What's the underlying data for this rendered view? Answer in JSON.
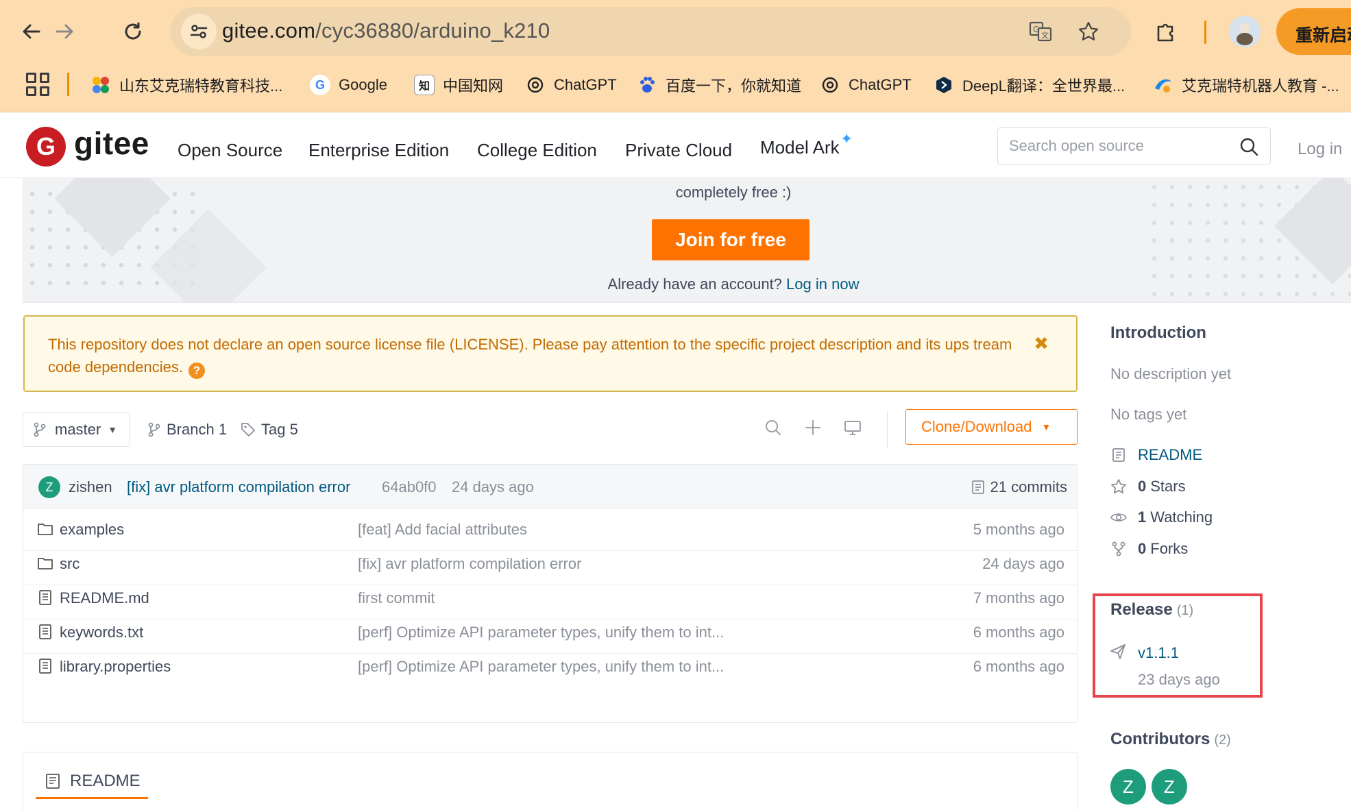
{
  "browser": {
    "url_host": "gitee.com",
    "url_path": "/cyc36880/arduino_k210",
    "relaunch_label": "重新启动",
    "bookmarks": [
      {
        "label": "山东艾克瑞特教育科技...",
        "icon": "colorful-dots-icon"
      },
      {
        "label": "Google",
        "icon": "google-icon"
      },
      {
        "label": "中国知网",
        "icon": "cnki-icon"
      },
      {
        "label": "ChatGPT",
        "icon": "openai-icon"
      },
      {
        "label": "百度一下，你就知道",
        "icon": "baidu-icon"
      },
      {
        "label": "ChatGPT",
        "icon": "openai-icon"
      },
      {
        "label": "DeepL翻译：全世界最...",
        "icon": "deepl-icon"
      },
      {
        "label": "艾克瑞特机器人教育 -...",
        "icon": "blue-swoosh-icon"
      }
    ]
  },
  "header": {
    "logo_letter": "G",
    "logo_text": "gitee",
    "nav": [
      "Open Source",
      "Enterprise Edition",
      "College Edition",
      "Private Cloud",
      "Model Ark"
    ],
    "search_placeholder": "Search open source",
    "login_label": "Log in"
  },
  "hero": {
    "tagline_tail": "completely free :)",
    "join_label": "Join for free",
    "account_text": "Already have an account?",
    "login_now": "Log in now"
  },
  "alert": {
    "text": "This repository does not declare an open source license file (LICENSE). Please pay attention to the specific project description and its ups tream code dependencies.",
    "help": "?",
    "close": "✖"
  },
  "toolbar": {
    "branch": "master",
    "branch_count": "Branch 1",
    "tag_count": "Tag 5",
    "clone_label": "Clone/Download"
  },
  "commit": {
    "avatar": "Z",
    "author": "zishen",
    "message": "[fix] avr platform compilation error",
    "sha": "64ab0f0",
    "time": "24 days ago",
    "commits": "21 commits"
  },
  "files": [
    {
      "name": "examples",
      "type": "folder",
      "message": "[feat] Add facial attributes",
      "time": "5 months ago"
    },
    {
      "name": "src",
      "type": "folder",
      "message": "[fix] avr platform compilation error",
      "time": "24 days ago"
    },
    {
      "name": "README.md",
      "type": "file",
      "message": "first commit",
      "time": "7 months ago"
    },
    {
      "name": "keywords.txt",
      "type": "file",
      "message": "[perf] Optimize API parameter types, unify them to int...",
      "time": "6 months ago"
    },
    {
      "name": "library.properties",
      "type": "file",
      "message": "[perf] Optimize API parameter types, unify them to int...",
      "time": "6 months ago"
    }
  ],
  "readme_tab": "README",
  "sidebar": {
    "intro_title": "Introduction",
    "no_description": "No description yet",
    "no_tags": "No tags yet",
    "readme": "README",
    "stars_count": "0",
    "stars_label": "Stars",
    "watching_count": "1",
    "watching_label": "Watching",
    "forks_count": "0",
    "forks_label": "Forks",
    "release_title": "Release",
    "release_count": "(1)",
    "release_version": "v1.1.1",
    "release_time": "23 days ago",
    "contributors_title": "Contributors",
    "contributors_count": "(2)",
    "contributors": [
      "Z",
      "Z"
    ]
  },
  "colors": {
    "accent": "#fe7300",
    "link": "#005980",
    "highlight_box": "#e8444b",
    "chrome_bg": "#fddcb0"
  }
}
